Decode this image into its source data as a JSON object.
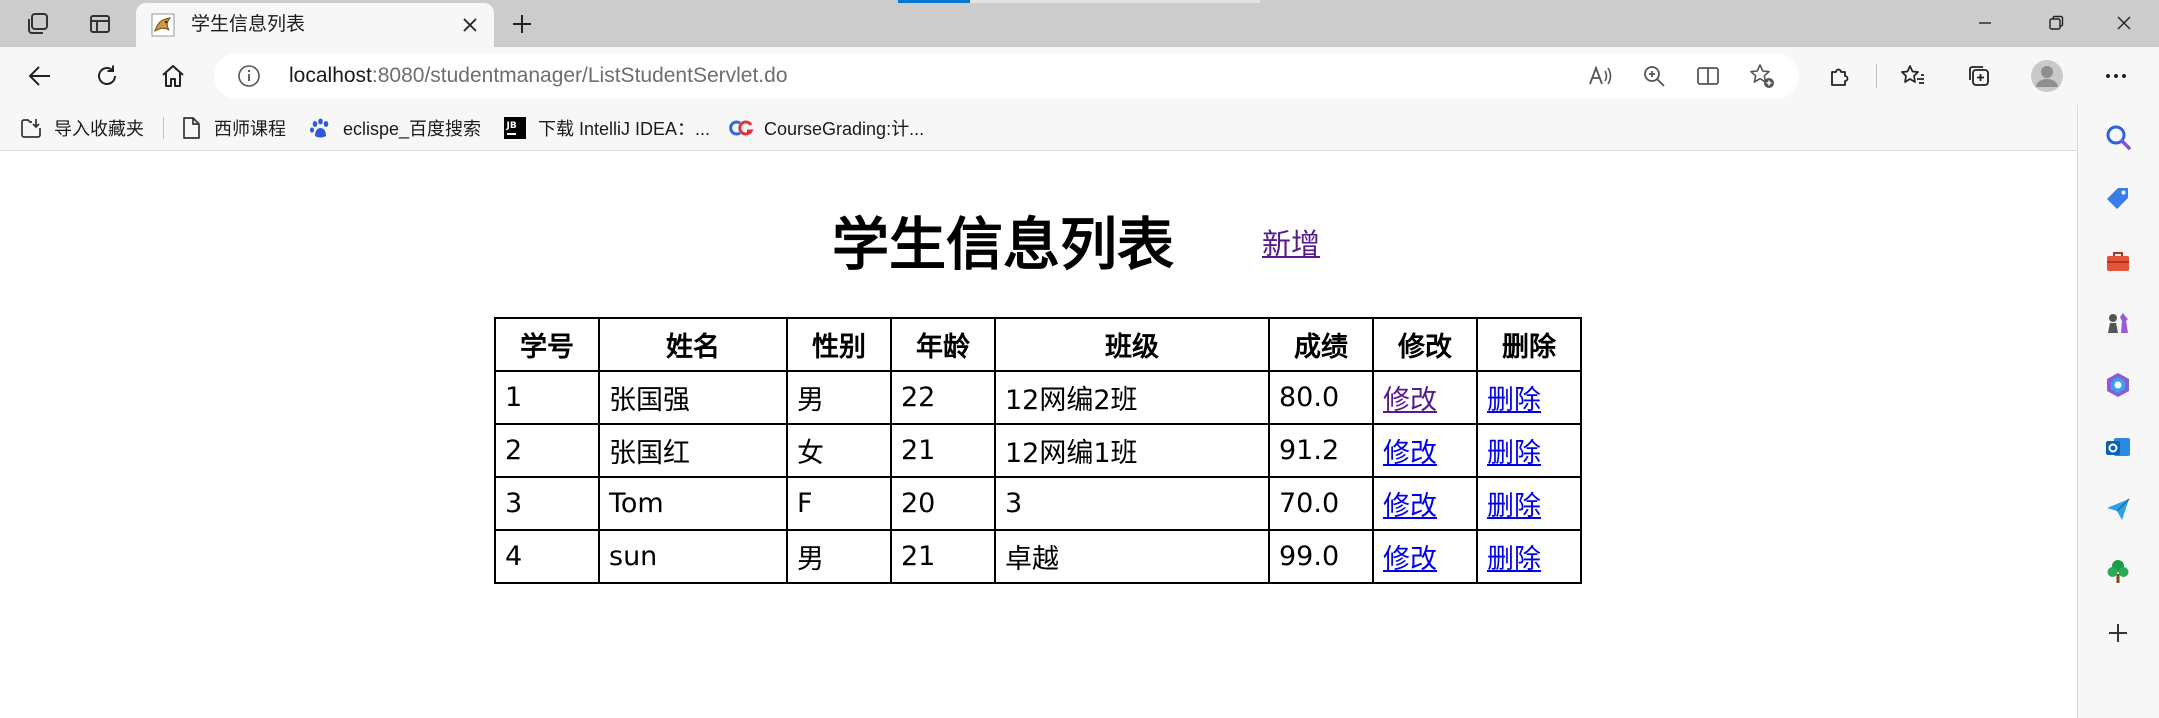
{
  "browser": {
    "tab": {
      "title": "学生信息列表"
    },
    "address": {
      "host": "localhost",
      "path": ":8080/studentmanager/ListStudentServlet.do"
    },
    "favorites": [
      {
        "label": "导入收藏夹",
        "icon": "import-favorites-icon"
      },
      {
        "label": "西师课程",
        "icon": "page-icon"
      },
      {
        "label": "eclispe_百度搜索",
        "icon": "baidu-paw-icon"
      },
      {
        "label": "下载 IntelliJ IDEA：...",
        "icon": "jetbrains-icon"
      },
      {
        "label": "CourseGrading:计...",
        "icon": "coursegrading-icon"
      }
    ],
    "colors": {
      "tabstrip": "#cccccc",
      "toolbar": "#f7f7f7",
      "loading_accent": "#0078d4"
    }
  },
  "page": {
    "title": "学生信息列表",
    "add_link": "新增",
    "table": {
      "headers": [
        "学号",
        "姓名",
        "性别",
        "年龄",
        "班级",
        "成绩",
        "修改",
        "删除"
      ],
      "rows": [
        {
          "id": "1",
          "name": "张国强",
          "sex": "男",
          "age": "22",
          "class": "12网编2班",
          "score": "80.0",
          "edit": "修改",
          "delete": "删除"
        },
        {
          "id": "2",
          "name": "张国红",
          "sex": "女",
          "age": "21",
          "class": "12网编1班",
          "score": "91.2",
          "edit": "修改",
          "delete": "删除"
        },
        {
          "id": "3",
          "name": "Tom",
          "sex": "F",
          "age": "20",
          "class": "3",
          "score": "70.0",
          "edit": "修改",
          "delete": "删除"
        },
        {
          "id": "4",
          "name": "sun",
          "sex": "男",
          "age": "21",
          "class": "卓越",
          "score": "99.0",
          "edit": "修改",
          "delete": "删除"
        }
      ]
    },
    "colors": {
      "link": "#0000ee",
      "visited_link": "#551a8b"
    }
  }
}
